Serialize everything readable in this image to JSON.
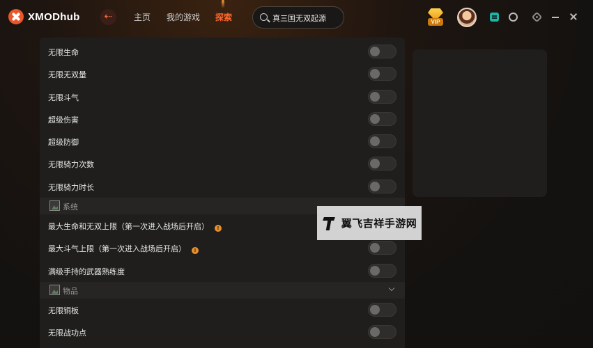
{
  "app": {
    "logo_text": "XMODhub"
  },
  "nav": {
    "back_icon": "arrow-left-icon",
    "items": [
      "主页",
      "我的游戏",
      "探索"
    ],
    "active_index": 2
  },
  "search": {
    "value": "真三国无双起源",
    "icon": "search-icon"
  },
  "header_icons": {
    "vip_label": "VIP"
  },
  "colors": {
    "accent": "#ff6a2e",
    "panel": "#1f1e1d",
    "info": "#e8912c"
  },
  "cheats": {
    "group_main": [
      "无限生命",
      "无限无双量",
      "无限斗气",
      "超级伤害",
      "超级防御",
      "无限骑力次数",
      "无限骑力时长"
    ],
    "section_system": "系统",
    "group_system": [
      {
        "label": "最大生命和无双上限（第一次进入战场后开启）",
        "info": "!"
      },
      {
        "label": "最大斗气上限（第一次进入战场后开启）",
        "info": "!"
      },
      {
        "label": "满级手持的武器熟练度"
      }
    ],
    "section_items": "物品",
    "group_items": [
      "无限铜板",
      "无限战功点"
    ]
  },
  "watermark": {
    "text": "翼飞吉祥手游网"
  }
}
